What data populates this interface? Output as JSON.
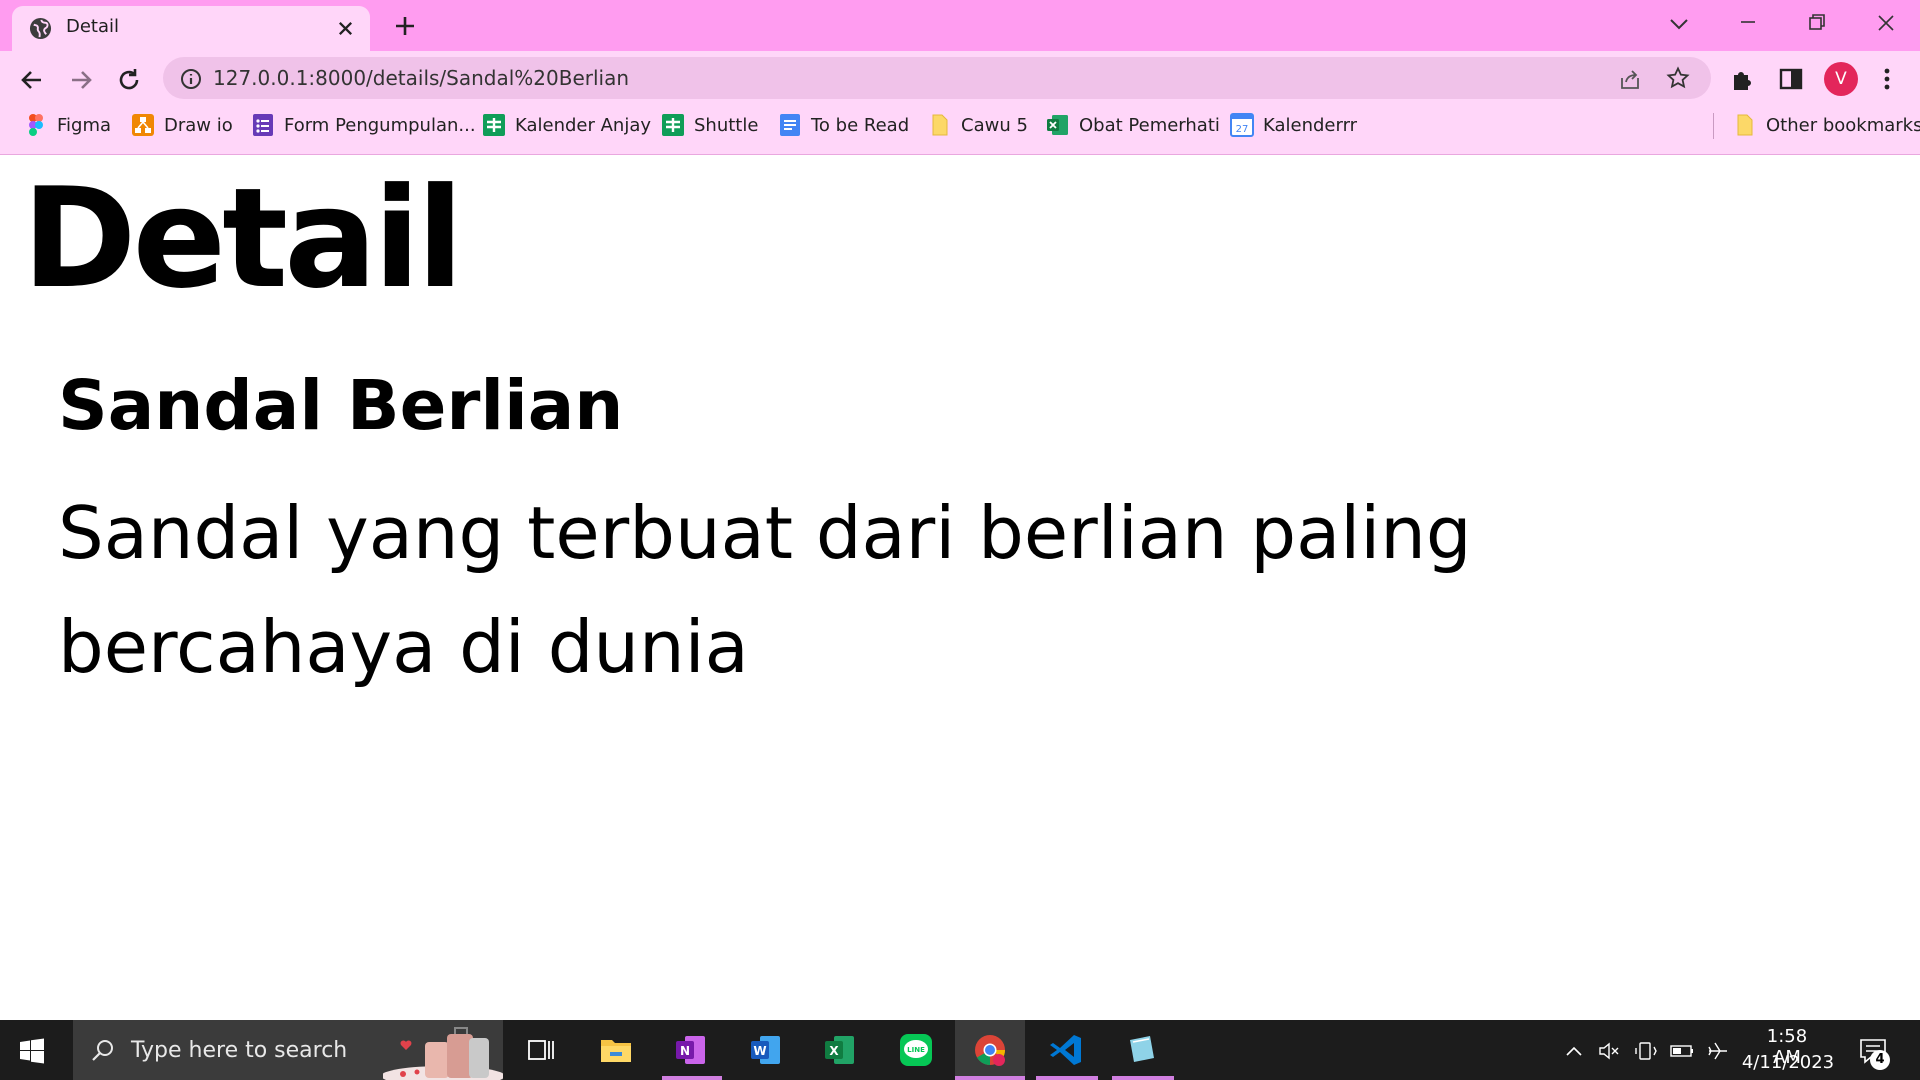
{
  "browser": {
    "tab": {
      "title": "Detail",
      "favicon": "globe-icon"
    },
    "address_bar": {
      "url": "127.0.0.1:8000/details/Sandal%20Berlian"
    },
    "profile_initial": "V",
    "bookmarks": [
      {
        "label": "Figma",
        "icon": "figma-icon"
      },
      {
        "label": "Draw io",
        "icon": "drawio-icon"
      },
      {
        "label": "Form Pengumpulan...",
        "icon": "forms-icon"
      },
      {
        "label": "Kalender Anjay",
        "icon": "sheets-icon"
      },
      {
        "label": "Shuttle",
        "icon": "sheets-icon"
      },
      {
        "label": "To be Read",
        "icon": "docs-icon"
      },
      {
        "label": "Cawu 5",
        "icon": "folder-icon"
      },
      {
        "label": "Obat Pemerhati",
        "icon": "excel-icon"
      },
      {
        "label": "Kalenderrr",
        "icon": "calendar-icon"
      }
    ],
    "other_bookmarks": "Other bookmarks",
    "colors": {
      "tabbar": "#ff9cf0",
      "toolbar": "#ffd6f9",
      "omnibox": "#f0c2e9",
      "profile": "#e3265b"
    }
  },
  "page": {
    "heading": "Detail",
    "product_name": "Sandal Berlian",
    "product_description": "Sandal yang terbuat dari berlian paling bercahaya di dunia"
  },
  "taskbar": {
    "search_placeholder": "Type here to search",
    "apps": [
      "task-view-icon",
      "file-explorer-icon",
      "onenote-icon",
      "word-icon",
      "excel-icon",
      "line-icon",
      "chrome-icon",
      "vscode-icon",
      "notepad-icon"
    ],
    "time": "1:58 AM",
    "date": "4/11/2023",
    "notification_count": "4"
  }
}
